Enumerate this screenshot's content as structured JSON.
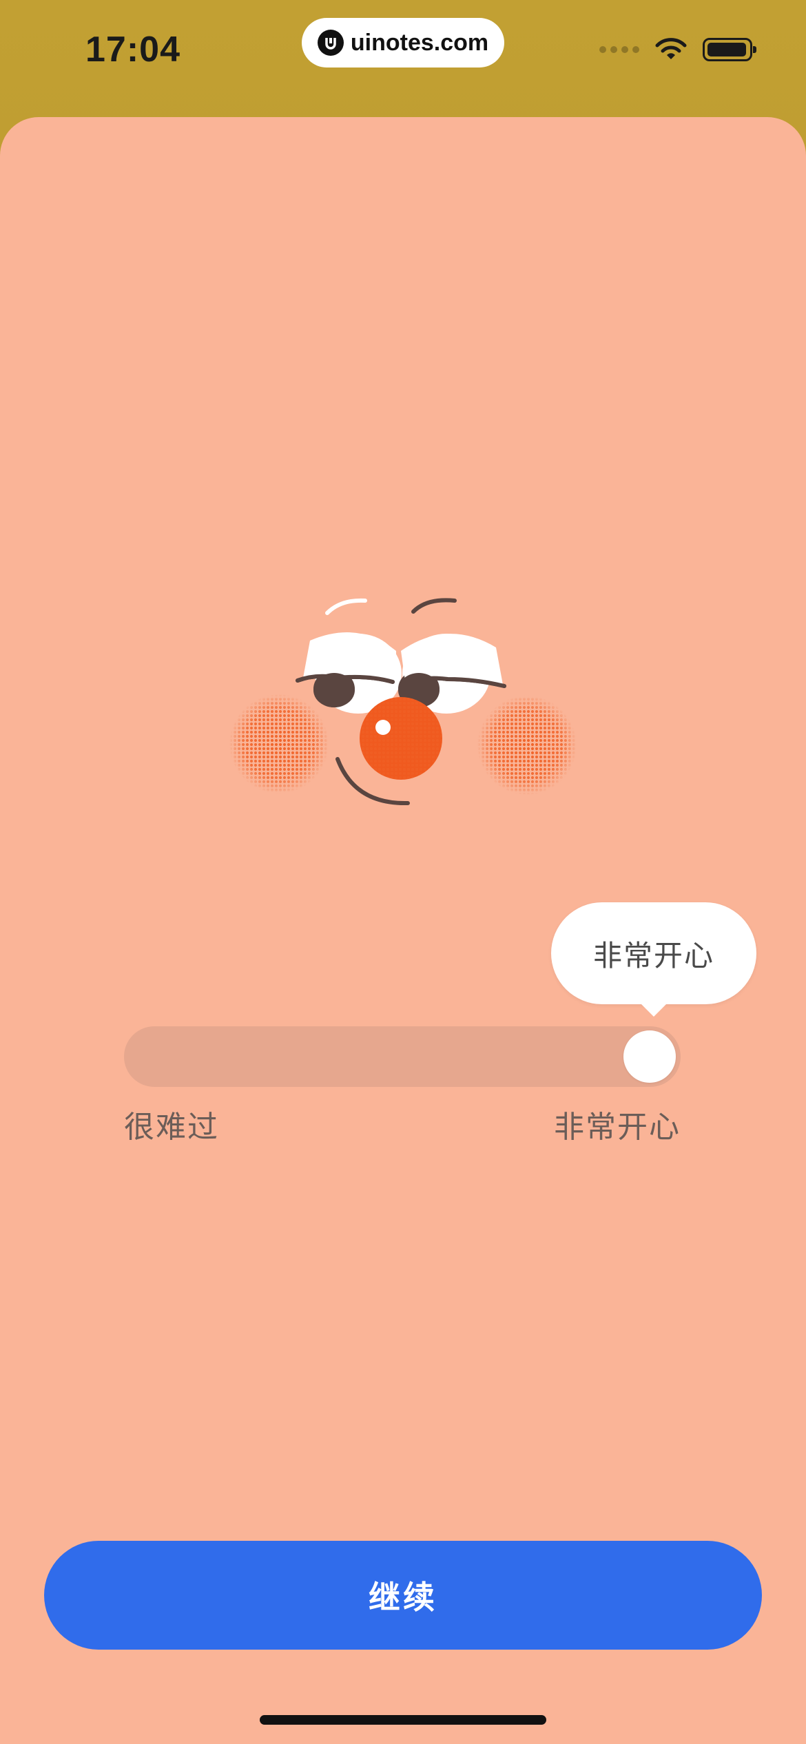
{
  "status_bar": {
    "time": "17:04",
    "url": "uinotes.com",
    "icons": [
      "signal-icon",
      "wifi-icon",
      "battery-icon"
    ]
  },
  "mood": {
    "tooltip": "非常开心",
    "slider_value": 1.0,
    "min_label": "很难过",
    "max_label": "非常开心"
  },
  "actions": {
    "continue_label": "继续"
  },
  "colors": {
    "background": "#fab497",
    "status_bar": "#b8962c",
    "button": "#306ceb",
    "nose": "#f05a1f",
    "cheeks": "#f0642a",
    "face_lines": "#5a4540"
  }
}
